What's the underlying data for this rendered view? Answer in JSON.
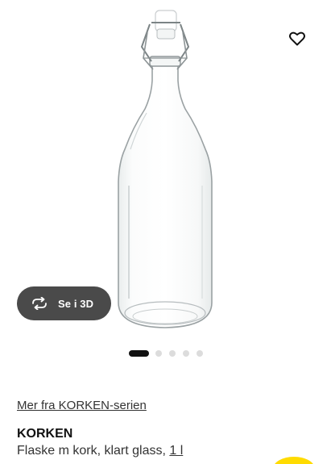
{
  "gallery": {
    "image_alt": "KORKEN flaske",
    "view3d_label": "Se i 3D",
    "dot_count": 5,
    "active_dot": 1
  },
  "series_link": "Mer fra KORKEN-serien",
  "product": {
    "name": "KORKEN",
    "description": "Flaske m kork, klart glass, ",
    "size": "1 l"
  },
  "colors": {
    "view3d_bg": "#4a4a4a",
    "accent_yellow": "#ffdb00",
    "dot_active": "#111111",
    "dot_inactive": "#dcdcdc"
  }
}
